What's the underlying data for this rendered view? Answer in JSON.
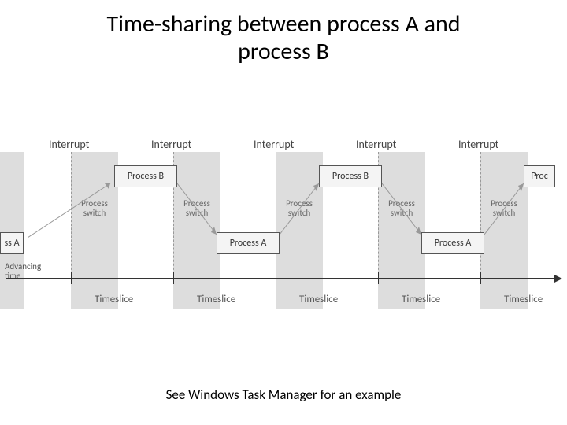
{
  "title_line1": "Time-sharing between process A and",
  "title_line2": "process B",
  "caption": "See Windows Task Manager for an example",
  "advancing_time": "Advancing\ntime",
  "processA": "Process A",
  "processB": "Process B",
  "processA_trunc": "ss A",
  "proc_trunc": "Proc",
  "interrupt": "Interrupt",
  "process_switch": "Process\nswitch",
  "timeslice": "Timeslice",
  "chart_data": {
    "type": "timeline",
    "title": "Time-sharing between process A and process B",
    "axis_label": "Advancing time",
    "interrupts": [
      0,
      1,
      2,
      3,
      4
    ],
    "segments": [
      {
        "slot": 0,
        "running": "A",
        "label_truncated": "ss A"
      },
      {
        "slot": 1,
        "running": "B"
      },
      {
        "slot": 2,
        "running": "A"
      },
      {
        "slot": 3,
        "running": "B"
      },
      {
        "slot": 4,
        "running": "A"
      },
      {
        "slot": 5,
        "running": "Proc",
        "label_truncated": "Proc"
      }
    ],
    "switches": [
      "A→B",
      "B→A",
      "A→B",
      "B→A",
      "A→B"
    ],
    "slot_label": "Timeslice",
    "process_B_y": "high",
    "process_A_y": "low"
  }
}
